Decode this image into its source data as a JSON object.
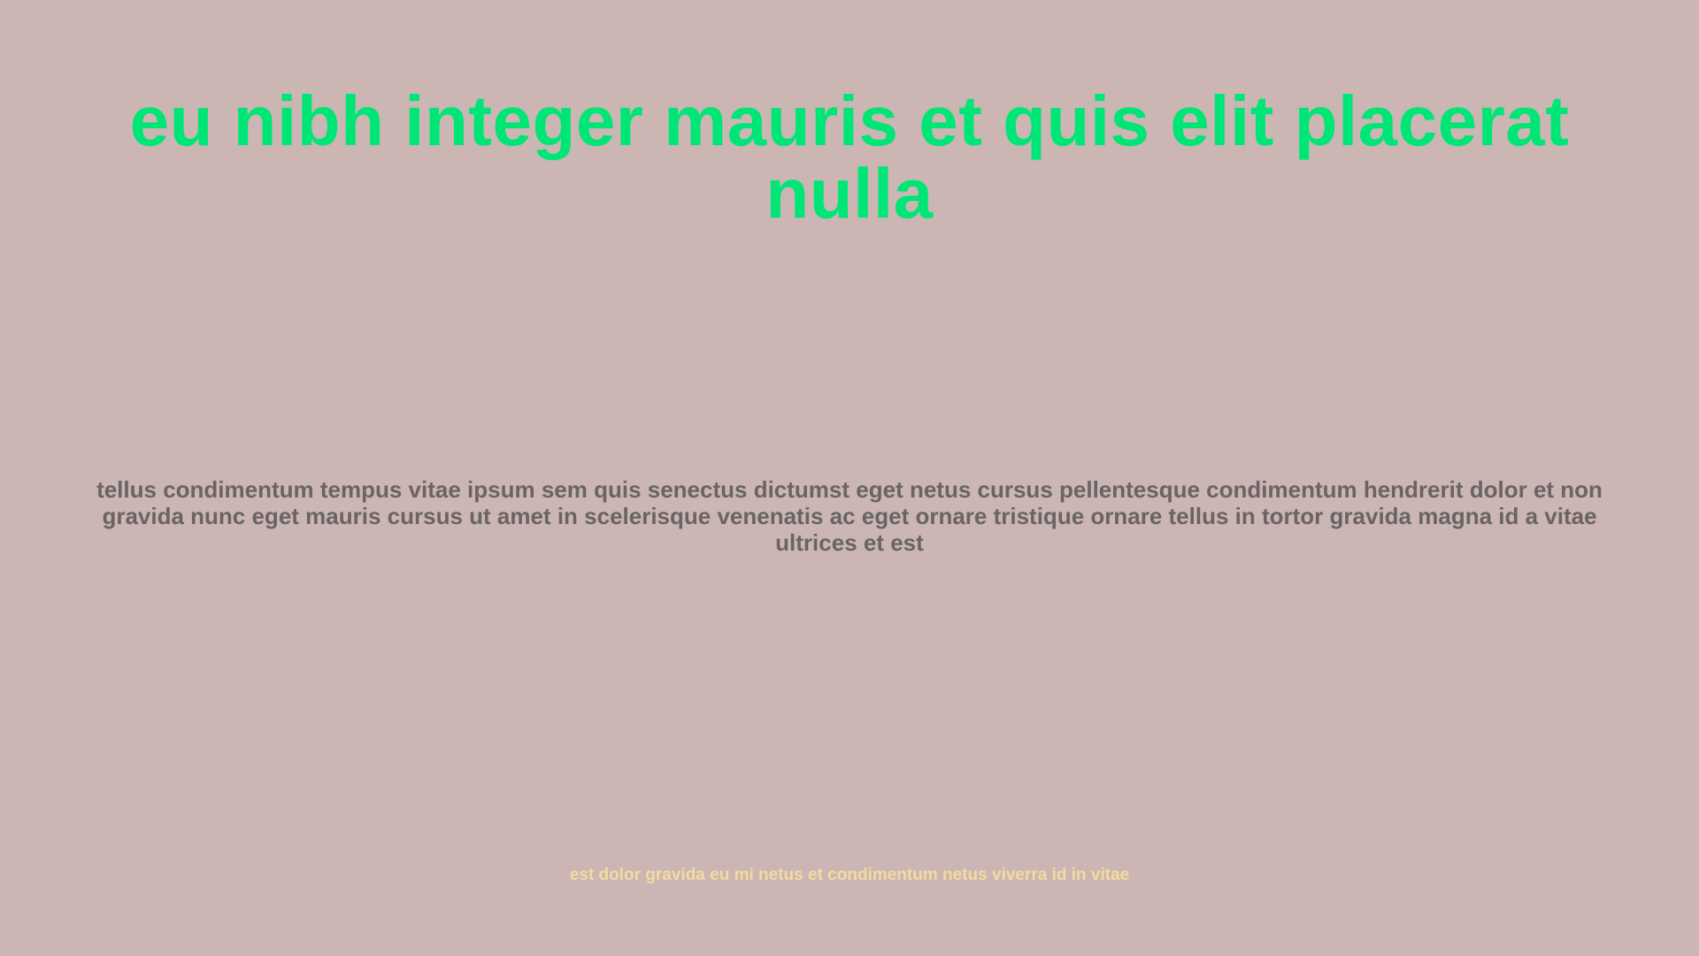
{
  "page": {
    "title": "eu nibh integer mauris et quis elit placerat nulla",
    "body": "tellus condimentum tempus vitae ipsum sem quis senectus dictumst eget netus cursus pellentesque condimentum hendrerit dolor et non gravida nunc eget mauris cursus ut amet in scelerisque venenatis ac eget ornare tristique ornare tellus in tortor gravida magna id a vitae ultrices et est",
    "footer": "est dolor gravida eu mi netus et condimentum netus viverra id in vitae"
  },
  "colors": {
    "background": "#cbb6b4",
    "title": "#00e676",
    "body": "#6a6464",
    "footer": "#f3dba0"
  }
}
